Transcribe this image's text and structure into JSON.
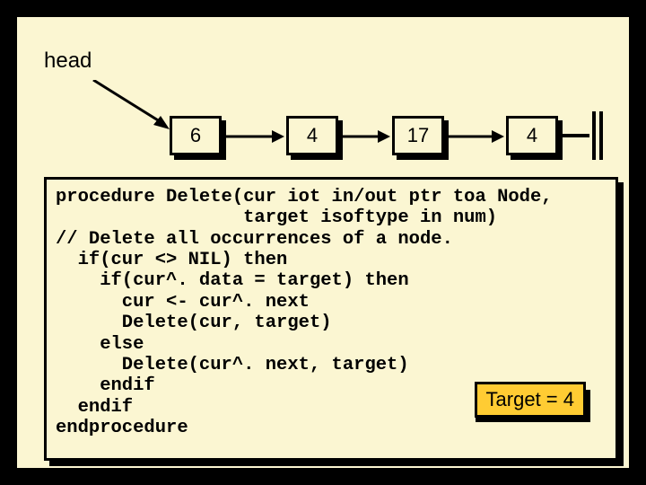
{
  "labels": {
    "head": "head"
  },
  "nodes": {
    "n1": "6",
    "n2": "4",
    "n3": "17",
    "n4": "4"
  },
  "code": "procedure Delete(cur iot in/out ptr toa Node,\n                 target isoftype in num)\n// Delete all occurrences of a node.\n  if(cur <> NIL) then\n    if(cur^. data = target) then\n      cur <- cur^. next\n      Delete(cur, target)\n    else\n      Delete(cur^. next, target)\n    endif\n  endif\nendprocedure",
  "target_label": "Target = 4",
  "chart_data": {
    "type": "diagram",
    "description": "Singly linked list with head pointer and four nodes; pseudocode box describes recursive Delete procedure removing all occurrences of target value 4.",
    "linked_list": [
      6,
      4,
      17,
      4
    ],
    "target": 4
  }
}
